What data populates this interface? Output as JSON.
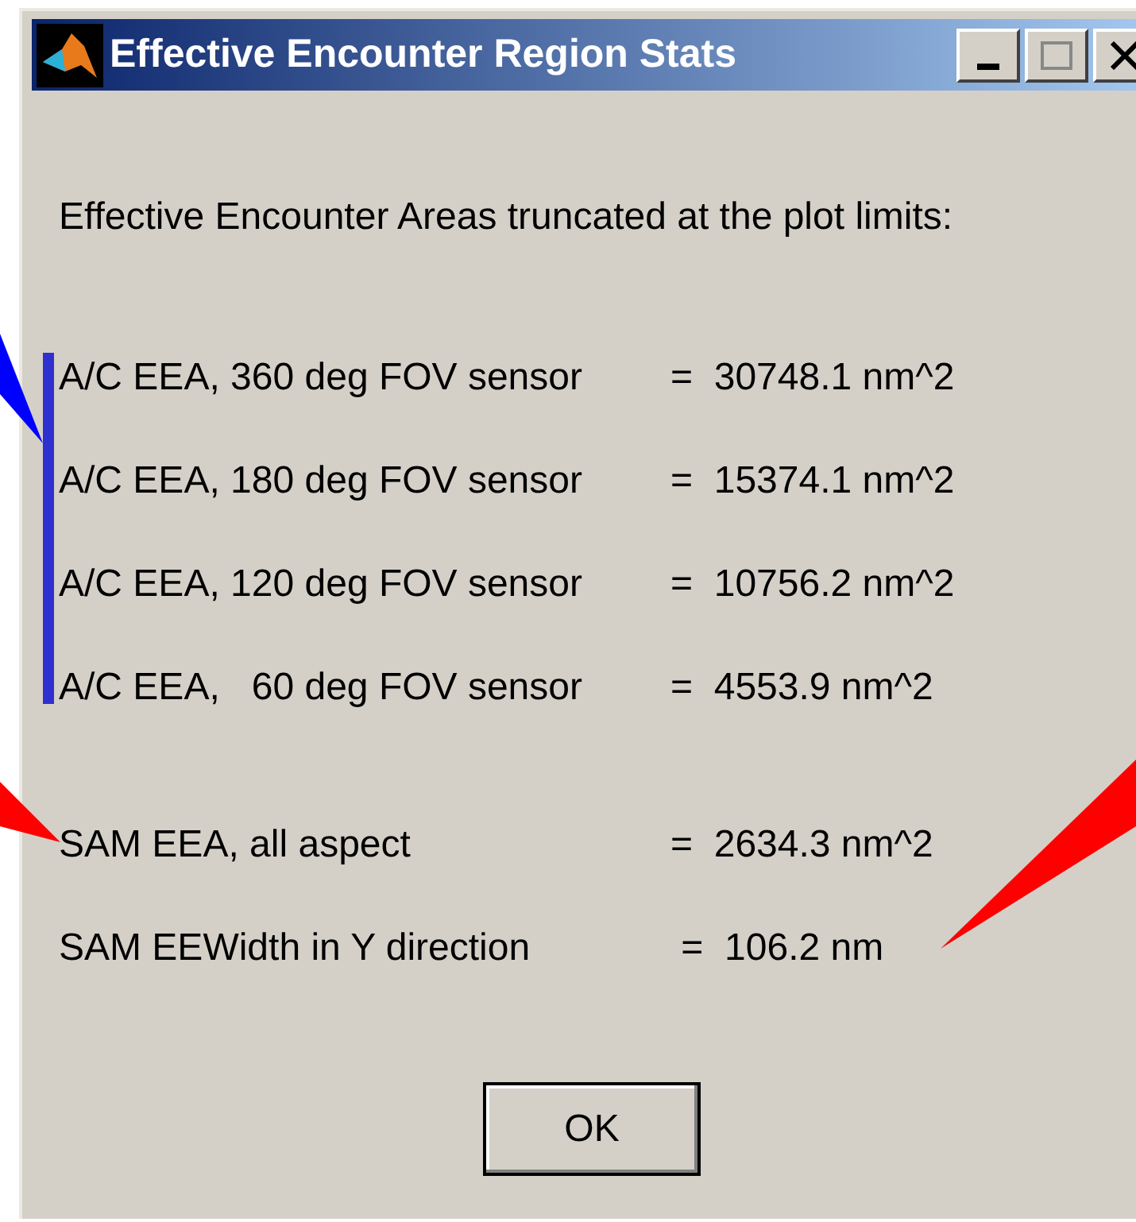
{
  "window": {
    "title": "Effective Encounter Region Stats"
  },
  "heading": "Effective Encounter Areas truncated at the plot limits:",
  "aircraft_rows": [
    {
      "label": "A/C EEA, 360 deg FOV sensor",
      "value": "=  30748.1 nm^2"
    },
    {
      "label": "A/C EEA, 180 deg FOV sensor",
      "value": "=  15374.1 nm^2"
    },
    {
      "label": "A/C EEA, 120 deg FOV sensor",
      "value": "=  10756.2 nm^2"
    },
    {
      "label": "A/C EEA,   60 deg FOV sensor",
      "value": "=  4553.9 nm^2"
    }
  ],
  "sam_rows": [
    {
      "label": "SAM EEA, all aspect",
      "value": "=  2634.3 nm^2"
    },
    {
      "label": "SAM EEWidth in Y direction",
      "value": " =  106.2 nm"
    }
  ],
  "button": "OK"
}
